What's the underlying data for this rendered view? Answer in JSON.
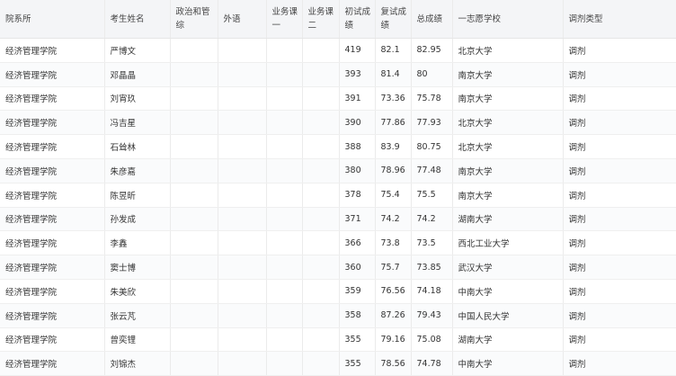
{
  "table": {
    "headers": [
      {
        "key": "dept",
        "label": "院系所"
      },
      {
        "key": "name",
        "label": "考生姓名"
      },
      {
        "key": "politics",
        "label": "政治和管综"
      },
      {
        "key": "foreign",
        "label": "外语"
      },
      {
        "key": "course1",
        "label": "业务课一"
      },
      {
        "key": "course2",
        "label": "业务课二"
      },
      {
        "key": "initial",
        "label": "初试成绩"
      },
      {
        "key": "retest",
        "label": "复试成绩"
      },
      {
        "key": "total",
        "label": "总成绩"
      },
      {
        "key": "school",
        "label": "一志愿学校"
      },
      {
        "key": "type",
        "label": "调剂类型"
      }
    ],
    "rows": [
      [
        "经济管理学院",
        "严博文",
        "",
        "",
        "",
        "",
        "419",
        "82.1",
        "82.95",
        "北京大学",
        "调剂"
      ],
      [
        "经济管理学院",
        "邓晶晶",
        "",
        "",
        "",
        "",
        "393",
        "81.4",
        "80",
        "南京大学",
        "调剂"
      ],
      [
        "经济管理学院",
        "刘宵玖",
        "",
        "",
        "",
        "",
        "391",
        "73.36",
        "75.78",
        "南京大学",
        "调剂"
      ],
      [
        "经济管理学院",
        "冯吉星",
        "",
        "",
        "",
        "",
        "390",
        "77.86",
        "77.93",
        "北京大学",
        "调剂"
      ],
      [
        "经济管理学院",
        "石耸林",
        "",
        "",
        "",
        "",
        "388",
        "83.9",
        "80.75",
        "北京大学",
        "调剂"
      ],
      [
        "经济管理学院",
        "朱彦嘉",
        "",
        "",
        "",
        "",
        "380",
        "78.96",
        "77.48",
        "南京大学",
        "调剂"
      ],
      [
        "经济管理学院",
        "陈昱昕",
        "",
        "",
        "",
        "",
        "378",
        "75.4",
        "75.5",
        "南京大学",
        "调剂"
      ],
      [
        "经济管理学院",
        "孙发成",
        "",
        "",
        "",
        "",
        "371",
        "74.2",
        "74.2",
        "湖南大学",
        "调剂"
      ],
      [
        "经济管理学院",
        "李鑫",
        "",
        "",
        "",
        "",
        "366",
        "73.8",
        "73.5",
        "西北工业大学",
        "调剂"
      ],
      [
        "经济管理学院",
        "窦士博",
        "",
        "",
        "",
        "",
        "360",
        "75.7",
        "73.85",
        "武汉大学",
        "调剂"
      ],
      [
        "经济管理学院",
        "朱美欣",
        "",
        "",
        "",
        "",
        "359",
        "76.56",
        "74.18",
        "中南大学",
        "调剂"
      ],
      [
        "经济管理学院",
        "张云芃",
        "",
        "",
        "",
        "",
        "358",
        "87.26",
        "79.43",
        "中国人民大学",
        "调剂"
      ],
      [
        "经济管理学院",
        "曾奕锂",
        "",
        "",
        "",
        "",
        "355",
        "79.16",
        "75.08",
        "湖南大学",
        "调剂"
      ],
      [
        "经济管理学院",
        "刘锦杰",
        "",
        "",
        "",
        "",
        "355",
        "78.56",
        "74.78",
        "中南大学",
        "调剂"
      ]
    ]
  }
}
